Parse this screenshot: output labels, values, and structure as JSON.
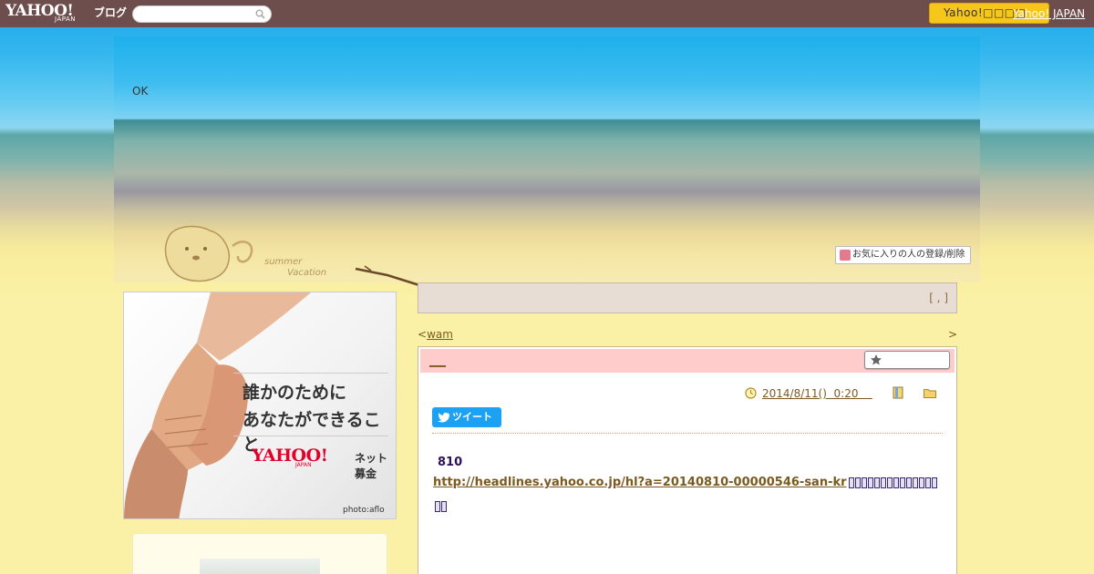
{
  "topbar": {
    "logo_text": "YAHOO!",
    "logo_sub": "JAPAN",
    "blog_label": "ブログ",
    "search_placeholder": "",
    "login_button_label": "Yahoo!□□□□",
    "yahoo_japan_link": "Yahoo! JAPAN"
  },
  "header": {
    "ok_text": "OK",
    "favorite_button_label": "お気に入りの人の登録/削除",
    "mascot_caption": "summer Vacation"
  },
  "sidebar": {
    "ad": {
      "line1": "誰かのために",
      "line2": "あなたができること",
      "logo": "YAHOO!",
      "logo_sub": "JAPAN",
      "service": "ネット募金",
      "credit": "photo:aflo"
    }
  },
  "main": {
    "title_bar_text": "[ , ]",
    "prev_arrow": "<",
    "prev_link": "wam",
    "next_arrow": ">",
    "article": {
      "title": "___",
      "date": "2014/8/11()  0:20    ",
      "tweet_label": "ツイート",
      "number": "810",
      "link": "http://headlines.yahoo.co.jp/hl?a=20140810-00000546-san-kr"
    }
  },
  "colors": {
    "topbar_bg": "#6d4e4d",
    "login_button_bg": "#f7c61b",
    "title_bar_bg": "#e8ddd4",
    "article_head_bg": "#ffcccc",
    "tweet_bg": "#1da1f2",
    "link_color": "#7a5a22"
  },
  "icons": {
    "search": "search-icon",
    "heart": "heart-icon",
    "star": "star-icon",
    "clock": "clock-icon",
    "book": "book-icon",
    "folder": "folder-icon",
    "bird": "twitter-bird-icon"
  }
}
